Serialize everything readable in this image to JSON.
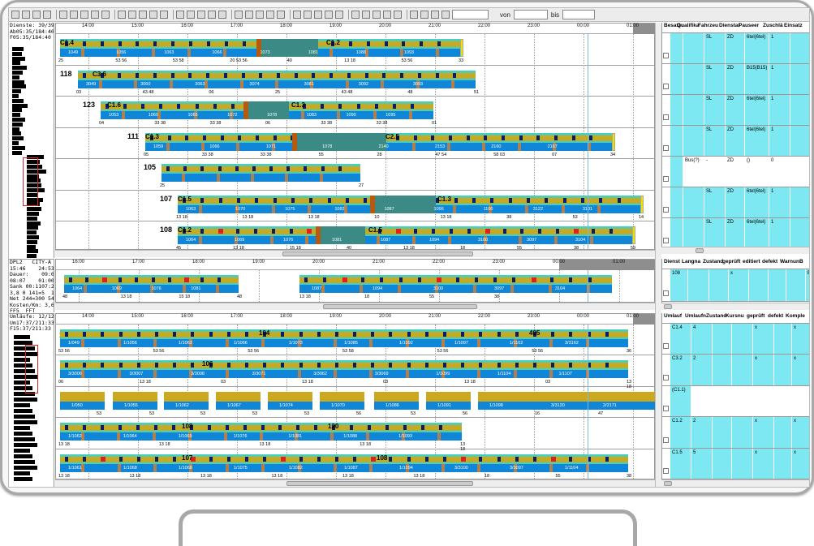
{
  "toolbar": {
    "from_label": "von",
    "to_label": "bis"
  },
  "info_top": [
    "Dienste: 39/39",
    "Ab05:35/184:40",
    "F05:35/184:40"
  ],
  "info_mid": [
    "DPL2   CITY-A",
    "15:46    24:53",
    "Dauer:    09:07",
    "08:07    01:00",
    "Sank 00:1107:22",
    "3,8 0 141=5  144",
    "Net 244=300 544",
    "Kosten/Km: 3,66",
    "FF5  FFT"
  ],
  "info_bot": [
    "Umläufe: 12/12",
    "Um17:37/211:33",
    "F15:37/211:33"
  ],
  "top_ticks": [
    "14:00",
    "15:00",
    "16:00",
    "17:00",
    "18:00",
    "19:00",
    "20:00",
    "21:00",
    "22:00",
    "23:00",
    "00:00",
    "01:00"
  ],
  "mid_ticks": [
    "16:00",
    "17:00",
    "18:00",
    "19:00",
    "20:00",
    "21:00",
    "22:00",
    "23:00",
    "00:00",
    "01:00"
  ],
  "bot_ticks": [
    "14:00",
    "15:00",
    "16:00",
    "17:00",
    "18:00",
    "19:00",
    "20:00",
    "21:00",
    "22:00",
    "23:00",
    "00:00",
    "01:00"
  ],
  "top_rows": [
    {
      "label": "",
      "tags": [
        "C1.4",
        "C1.2"
      ],
      "codes": [
        "1049",
        "1056",
        "1063",
        "1066",
        "1073",
        "1081",
        "1088",
        "1093"
      ],
      "nums": [
        "25",
        "53 56",
        "53 58",
        "20 53 56",
        "40",
        "13 18",
        "53 56",
        "33"
      ]
    },
    {
      "label": "118",
      "tags": [
        "C3.6"
      ],
      "codes": [
        "3049",
        "3060",
        "3063",
        "3074",
        "3081",
        "3092",
        "3093"
      ],
      "nums": [
        "03",
        "43 48",
        "06",
        "25",
        "43 48",
        "48",
        "51"
      ]
    },
    {
      "label": "123",
      "tags": [
        "C1.6",
        "C1.3"
      ],
      "codes": [
        "1053",
        "1060",
        "1065",
        "1072",
        "1078",
        "1083",
        "1090",
        "1095"
      ],
      "nums": [
        "04",
        "33 38",
        "33 38",
        "06",
        "33 38",
        "33 38",
        "01"
      ]
    },
    {
      "label": "111",
      "tags": [
        "C1.3",
        "C2.5"
      ],
      "codes": [
        "1059",
        "1066",
        "1071",
        "1078",
        "2140",
        "2153",
        "2160",
        "2167"
      ],
      "nums": [
        "05",
        "33 38",
        "33 38",
        "55",
        "28",
        "47 54",
        "58 03",
        "07",
        "34"
      ]
    },
    {
      "label": "105",
      "tags": [],
      "codes": [],
      "nums": [
        "25",
        "27"
      ]
    },
    {
      "label": "107",
      "tags": [
        "C1.5",
        "C1.3"
      ],
      "codes": [
        "1063",
        "1070",
        "1075",
        "1082",
        "1087",
        "1096",
        "1100",
        "3122",
        "3101"
      ],
      "nums": [
        "13 18",
        "13 18",
        "13 18",
        "10",
        "13 18",
        "38",
        "53",
        "14"
      ]
    },
    {
      "label": "108",
      "tags": [
        "C1.2",
        "C1.5"
      ],
      "codes": [
        "1064",
        "1069",
        "1076",
        "1081",
        "1087",
        "1094",
        "3100",
        "3097",
        "3104"
      ],
      "nums": [
        "45",
        "13 18",
        "15 18",
        "40",
        "13 18",
        "18",
        "55",
        "38",
        "59"
      ]
    }
  ],
  "mid_row": {
    "codes": [
      "1064",
      "1069",
      "1076",
      "1081",
      "1087",
      "1094",
      "3100",
      "3097",
      "3104"
    ],
    "nums": [
      "48",
      "13 18",
      "15 18",
      "48",
      "13 18",
      "18",
      "55",
      "38"
    ]
  },
  "bot_rows": [
    {
      "label": "120",
      "tags": [
        "104",
        "405"
      ],
      "codes": [
        "1/049",
        "1/1056",
        "1/1063",
        "1/1066",
        "1/1073",
        "1/1085",
        "1/1092",
        "1/1097",
        "1/1102",
        "3/3162"
      ],
      "nums": [
        "53 56",
        "53 56",
        "53 56",
        "53 58",
        "53 56",
        "53 56",
        "36"
      ]
    },
    {
      "label": "",
      "tags": [
        "106"
      ],
      "codes": [
        "3/3006",
        "3/3007",
        "3/3008",
        "3/3071",
        "3/3062",
        "3/3069",
        "1/1099",
        "1/1104",
        "1/1107"
      ],
      "nums": [
        "06",
        "13 18",
        "03",
        "13 18",
        "03",
        "13 18",
        "03",
        "13 18"
      ]
    },
    {
      "label": "",
      "tags": [],
      "codes": [
        "1/050",
        "1/1055",
        "1/1062",
        "1/1067",
        "1/1074",
        "1/1070",
        "1/1086",
        "1/1091",
        "1/1098",
        "3/3120",
        "2/2171"
      ],
      "nums": [
        "53",
        "53",
        "53",
        "53",
        "53",
        "56",
        "53",
        "56",
        "16",
        "47"
      ]
    },
    {
      "label": "",
      "tags": [
        "108",
        "120"
      ],
      "codes": [
        "1/1062",
        "1/1064",
        "1/1069",
        "1/1076",
        "1/1081",
        "1/1088",
        "1/1093"
      ],
      "nums": [
        "13 18",
        "13 18",
        "13 18",
        "13 18",
        "13 18"
      ]
    },
    {
      "label": "",
      "tags": [
        "107",
        "108"
      ],
      "codes": [
        "1/1061",
        "1/1068",
        "1/1068",
        "1/1075",
        "1/1082",
        "1/1087",
        "1/1094",
        "3/3100",
        "3/3097",
        "1/1104"
      ],
      "nums": [
        "13 18",
        "13 18",
        "13 18",
        "13 18",
        "13 18",
        "13 18",
        "18",
        "55",
        "38"
      ]
    }
  ],
  "grid_top": {
    "headers": [
      "Besatzu",
      "Qualifika",
      "Fahrzeu",
      "Dienstar",
      "Pauseer",
      "Zuschlä",
      "Einsatz"
    ],
    "rows": [
      [
        "",
        "",
        "SL",
        "ZD",
        "6tel(6tel)",
        "1",
        ""
      ],
      [
        "",
        "",
        "SL",
        "ZD",
        "B15(B15)",
        "1",
        ""
      ],
      [
        "",
        "",
        "SL",
        "ZD",
        "6tel(6tel)",
        "1",
        ""
      ],
      [
        "",
        "",
        "SL",
        "ZD",
        "6tel(6tel)",
        "1",
        ""
      ],
      [
        "",
        "Bus(?)",
        "-",
        "ZD",
        "()",
        "0",
        ""
      ],
      [
        "",
        "",
        "SL",
        "ZD",
        "6tel(6tel)",
        "1",
        ""
      ],
      [
        "",
        "",
        "SL",
        "ZD",
        "6tel(6tel)",
        "1",
        ""
      ]
    ]
  },
  "grid_mid": {
    "headers": [
      "Dienst",
      "Langna",
      "Zustand",
      "geprüft",
      "editiert",
      "defekt",
      "Warnun",
      "B"
    ],
    "rows": [
      [
        "108",
        "",
        "",
        "x",
        "",
        "",
        "",
        "B"
      ]
    ]
  },
  "grid_bot": {
    "headers": [
      "Umlauf",
      "Umlaufn",
      "Zustand",
      "Kursnu",
      "geprüft",
      "defekt",
      "Komple"
    ],
    "rows": [
      [
        "C1.4",
        "4",
        "",
        "",
        "x",
        "",
        "x"
      ],
      [
        "C3.2",
        "2",
        "",
        "",
        "x",
        "",
        "x"
      ],
      [
        "(C1.1)",
        "",
        "",
        "",
        "",
        "",
        ""
      ],
      [
        "C1.2",
        "2",
        "",
        "",
        "x",
        "",
        "x"
      ],
      [
        "C1.5",
        "5",
        "",
        "",
        "x",
        "",
        "x"
      ]
    ]
  }
}
